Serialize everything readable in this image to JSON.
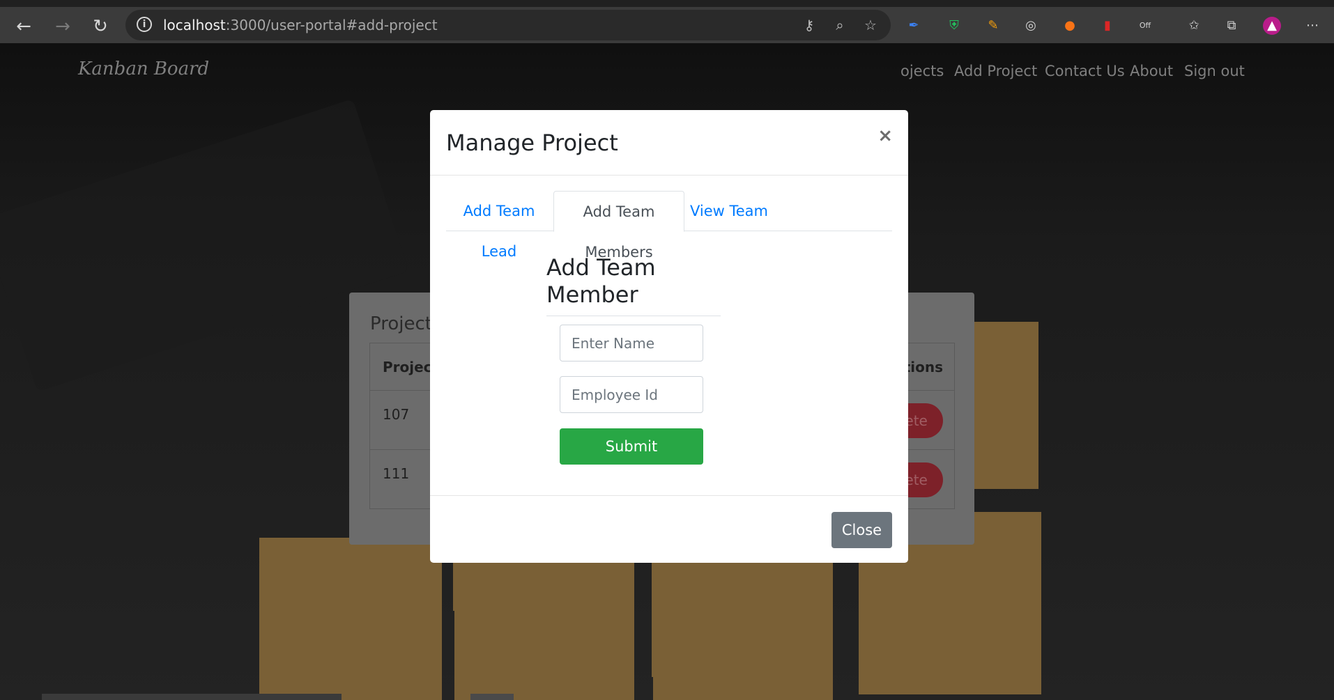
{
  "browser": {
    "url_host": "localhost",
    "url_rest": ":3000/user-portal#add-project",
    "back_icon": "arrow-left-icon",
    "forward_icon": "arrow-right-icon",
    "reload_icon": "reload-icon",
    "extension_badge": "Off"
  },
  "navbar": {
    "brand": "Kanban Board",
    "items": [
      "Projects",
      "Add Project",
      "Contact Us",
      "About",
      "Sign out"
    ],
    "visible_partial_first": "ojects"
  },
  "projects_card": {
    "title": "Projects",
    "header_col1": "Project",
    "header_col2": "Actions",
    "rows": [
      {
        "id": "107",
        "action": "Delete"
      },
      {
        "id": "111",
        "action": "Delete"
      }
    ]
  },
  "modal": {
    "title": "Manage Project",
    "close_symbol": "×",
    "tabs": [
      {
        "label": "Add Team Lead",
        "active": false
      },
      {
        "label": "Add Team Members",
        "active": true
      },
      {
        "label": "View Team",
        "active": false
      }
    ],
    "form": {
      "heading": "Add Team Member",
      "name_placeholder": "Enter Name",
      "id_placeholder": "Employee Id",
      "submit_label": "Submit"
    },
    "footer_close_label": "Close"
  },
  "colors": {
    "primary": "#007bff",
    "success": "#28a745",
    "secondary": "#6c757d",
    "danger_dim": "#7d2129"
  }
}
